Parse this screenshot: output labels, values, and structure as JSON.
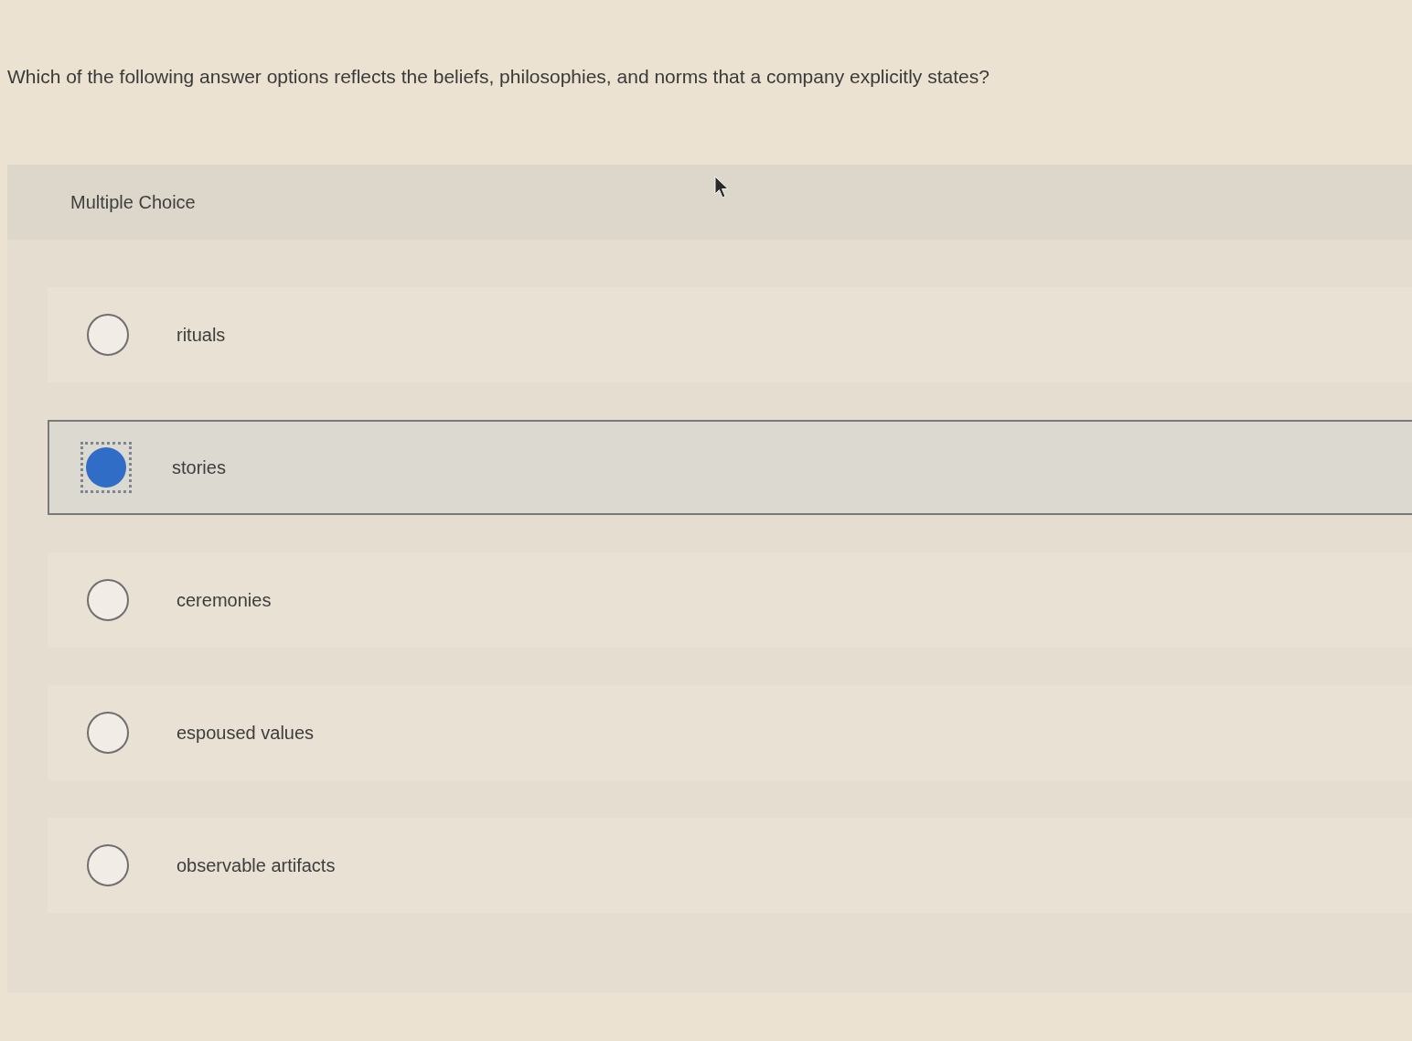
{
  "question": "Which of the following answer options reflects the beliefs, philosophies, and norms that a company explicitly states?",
  "section": {
    "title": "Multiple Choice"
  },
  "options": [
    {
      "label": "rituals",
      "selected": false
    },
    {
      "label": "stories",
      "selected": true
    },
    {
      "label": "ceremonies",
      "selected": false
    },
    {
      "label": "espoused values",
      "selected": false
    },
    {
      "label": "observable artifacts",
      "selected": false
    }
  ]
}
